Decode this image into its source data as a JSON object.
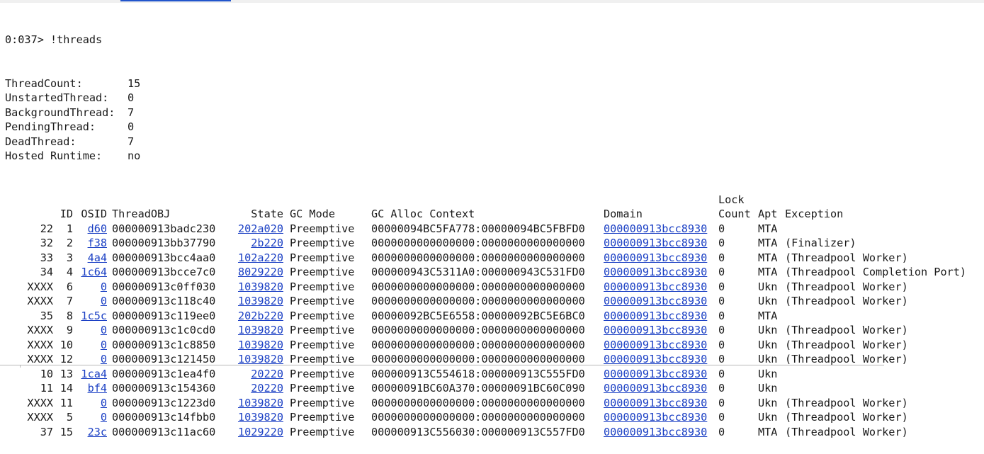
{
  "prompt": "0:037> !threads",
  "summary": [
    {
      "label": "ThreadCount:",
      "value": "15"
    },
    {
      "label": "UnstartedThread:",
      "value": "0"
    },
    {
      "label": "BackgroundThread:",
      "value": "7"
    },
    {
      "label": "PendingThread:",
      "value": "0"
    },
    {
      "label": "DeadThread:",
      "value": "7"
    },
    {
      "label": "Hosted Runtime:",
      "value": "no"
    }
  ],
  "table": {
    "header_top": {
      "lock": "Lock"
    },
    "columns": {
      "id": "ID",
      "osid": "OSID",
      "threadobj": "ThreadOBJ",
      "state": "State",
      "gc_mode": "GC Mode",
      "gc_alloc": "GC Alloc Context",
      "domain": "Domain",
      "lock": "Count",
      "apt": "Apt",
      "exception": "Exception"
    },
    "rows": [
      {
        "dbg": "22",
        "id": "1",
        "osid": "d60",
        "threadobj": "000000913badc230",
        "state": "202a020",
        "gc_mode": "Preemptive",
        "gc_alloc": "00000094BC5FA778:00000094BC5FBFD0",
        "domain": "000000913bcc8930",
        "lock": "0",
        "apt": "MTA",
        "exception": ""
      },
      {
        "dbg": "32",
        "id": "2",
        "osid": "f38",
        "threadobj": "000000913bb37790",
        "state": "2b220",
        "gc_mode": "Preemptive",
        "gc_alloc": "0000000000000000:0000000000000000",
        "domain": "000000913bcc8930",
        "lock": "0",
        "apt": "MTA",
        "exception": "(Finalizer)"
      },
      {
        "dbg": "33",
        "id": "3",
        "osid": "4a4",
        "threadobj": "000000913bcc4aa0",
        "state": "102a220",
        "gc_mode": "Preemptive",
        "gc_alloc": "0000000000000000:0000000000000000",
        "domain": "000000913bcc8930",
        "lock": "0",
        "apt": "MTA",
        "exception": "(Threadpool Worker)"
      },
      {
        "dbg": "34",
        "id": "4",
        "osid": "1c64",
        "threadobj": "000000913bcce7c0",
        "state": "8029220",
        "gc_mode": "Preemptive",
        "gc_alloc": "000000943C5311A0:000000943C531FD0",
        "domain": "000000913bcc8930",
        "lock": "0",
        "apt": "MTA",
        "exception": "(Threadpool Completion Port)"
      },
      {
        "dbg": "XXXX",
        "id": "6",
        "osid": "0",
        "threadobj": "000000913c0ff030",
        "state": "1039820",
        "gc_mode": "Preemptive",
        "gc_alloc": "0000000000000000:0000000000000000",
        "domain": "000000913bcc8930",
        "lock": "0",
        "apt": "Ukn",
        "exception": "(Threadpool Worker)"
      },
      {
        "dbg": "XXXX",
        "id": "7",
        "osid": "0",
        "threadobj": "000000913c118c40",
        "state": "1039820",
        "gc_mode": "Preemptive",
        "gc_alloc": "0000000000000000:0000000000000000",
        "domain": "000000913bcc8930",
        "lock": "0",
        "apt": "Ukn",
        "exception": "(Threadpool Worker)"
      },
      {
        "dbg": "35",
        "id": "8",
        "osid": "1c5c",
        "threadobj": "000000913c119ee0",
        "state": "202b220",
        "gc_mode": "Preemptive",
        "gc_alloc": "00000092BC5E6558:00000092BC5E6BC0",
        "domain": "000000913bcc8930",
        "lock": "0",
        "apt": "MTA",
        "exception": ""
      },
      {
        "dbg": "XXXX",
        "id": "9",
        "osid": "0",
        "threadobj": "000000913c1c0cd0",
        "state": "1039820",
        "gc_mode": "Preemptive",
        "gc_alloc": "0000000000000000:0000000000000000",
        "domain": "000000913bcc8930",
        "lock": "0",
        "apt": "Ukn",
        "exception": "(Threadpool Worker)"
      },
      {
        "dbg": "XXXX",
        "id": "10",
        "osid": "0",
        "threadobj": "000000913c1c8850",
        "state": "1039820",
        "gc_mode": "Preemptive",
        "gc_alloc": "0000000000000000:0000000000000000",
        "domain": "000000913bcc8930",
        "lock": "0",
        "apt": "Ukn",
        "exception": "(Threadpool Worker)"
      },
      {
        "dbg": "XXXX",
        "id": "12",
        "osid": "0",
        "threadobj": "000000913c121450",
        "state": "1039820",
        "gc_mode": "Preemptive",
        "gc_alloc": "0000000000000000:0000000000000000",
        "domain": "000000913bcc8930",
        "lock": "0",
        "apt": "Ukn",
        "exception": "(Threadpool Worker)"
      },
      {
        "dbg": "10",
        "id": "13",
        "osid": "1ca4",
        "threadobj": "000000913c1ea4f0",
        "state": "20220",
        "gc_mode": "Preemptive",
        "gc_alloc": "000000913C554618:000000913C555FD0",
        "domain": "000000913bcc8930",
        "lock": "0",
        "apt": "Ukn",
        "exception": ""
      },
      {
        "dbg": "11",
        "id": "14",
        "osid": "bf4",
        "threadobj": "000000913c154360",
        "state": "20220",
        "gc_mode": "Preemptive",
        "gc_alloc": "00000091BC60A370:00000091BC60C090",
        "domain": "000000913bcc8930",
        "lock": "0",
        "apt": "Ukn",
        "exception": ""
      },
      {
        "dbg": "XXXX",
        "id": "11",
        "osid": "0",
        "threadobj": "000000913c1223d0",
        "state": "1039820",
        "gc_mode": "Preemptive",
        "gc_alloc": "0000000000000000:0000000000000000",
        "domain": "000000913bcc8930",
        "lock": "0",
        "apt": "Ukn",
        "exception": "(Threadpool Worker)"
      },
      {
        "dbg": "XXXX",
        "id": "5",
        "osid": "0",
        "threadobj": "000000913c14fbb0",
        "state": "1039820",
        "gc_mode": "Preemptive",
        "gc_alloc": "0000000000000000:0000000000000000",
        "domain": "000000913bcc8930",
        "lock": "0",
        "apt": "Ukn",
        "exception": "(Threadpool Worker)"
      },
      {
        "dbg": "37",
        "id": "15",
        "osid": "23c",
        "threadobj": "000000913c11ac60",
        "state": "1029220",
        "gc_mode": "Preemptive",
        "gc_alloc": "000000913C556030:000000913C557FD0",
        "domain": "000000913bcc8930",
        "lock": "0",
        "apt": "MTA",
        "exception": "(Threadpool Worker)"
      }
    ]
  }
}
